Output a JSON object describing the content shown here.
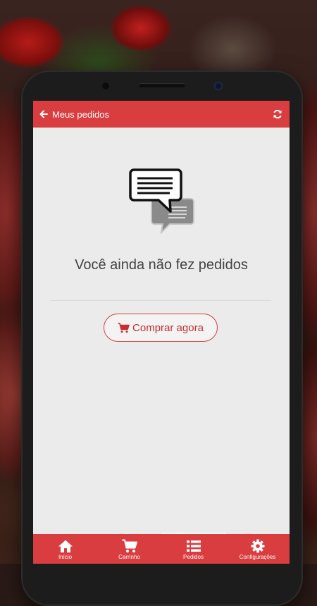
{
  "colors": {
    "accent": "#d93d3f",
    "screen_bg": "#ebebeb",
    "text": "#444444"
  },
  "appbar": {
    "title": "Meus pedidos",
    "back_icon": "arrow-left-icon",
    "refresh_icon": "refresh-icon"
  },
  "empty_state": {
    "icon": "chat-bubbles-icon",
    "message": "Você ainda não fez pedidos",
    "button_label": "Comprar agora",
    "button_icon": "cart-icon"
  },
  "bottom_nav": {
    "items": [
      {
        "label": "Início",
        "icon": "home-icon"
      },
      {
        "label": "Carrinho",
        "icon": "cart-icon"
      },
      {
        "label": "Pedidos",
        "icon": "list-icon"
      },
      {
        "label": "Configurações",
        "icon": "gear-icon"
      }
    ]
  }
}
